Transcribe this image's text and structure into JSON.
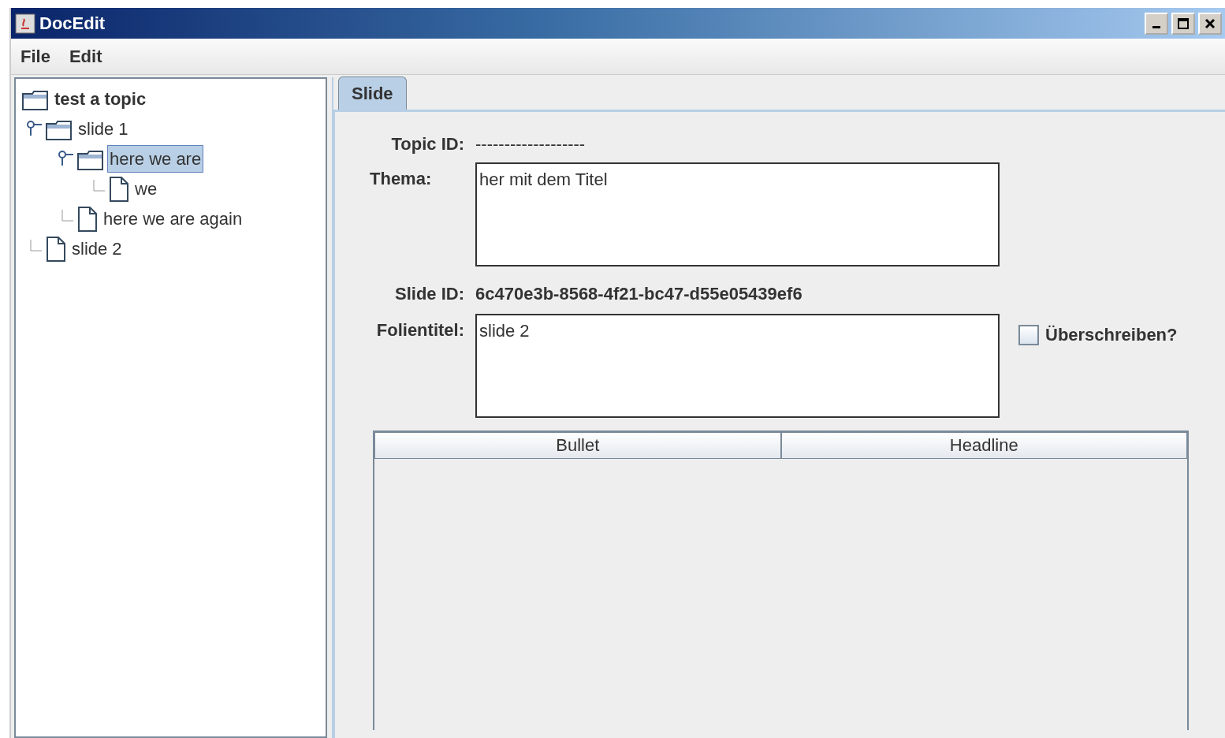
{
  "window": {
    "title": "DocEdit"
  },
  "menu": [
    {
      "label": "File"
    },
    {
      "label": "Edit"
    }
  ],
  "tree": {
    "label": "test a topic",
    "kind": "folder",
    "selected": false,
    "children": [
      {
        "label": "slide 1",
        "kind": "folder",
        "expanded": true,
        "selected": false,
        "children": [
          {
            "label": "here we are",
            "kind": "folder",
            "expanded": true,
            "selected": true,
            "children": [
              {
                "label": "we",
                "kind": "document",
                "selected": false
              }
            ]
          },
          {
            "label": "here we are again",
            "kind": "document",
            "selected": false
          }
        ]
      },
      {
        "label": "slide 2",
        "kind": "document",
        "selected": false
      }
    ]
  },
  "tabs": [
    {
      "label": "Slide",
      "selected": true
    }
  ],
  "form": {
    "topic_id_label": "Topic ID:",
    "topic_id": "-------------------",
    "thema_label": "Thema:",
    "thema": "her mit dem Titel",
    "slide_id_label": "Slide ID:",
    "slide_id": "6c470e3b-8568-4f21-bc47-d55e05439ef6",
    "folientitel_label": "Folientitel:",
    "folientitel": "slide 2",
    "overwrite": {
      "label": "Überschreiben?",
      "checked": false
    }
  },
  "table": {
    "columns": [
      "Bullet",
      "Headline"
    ]
  }
}
